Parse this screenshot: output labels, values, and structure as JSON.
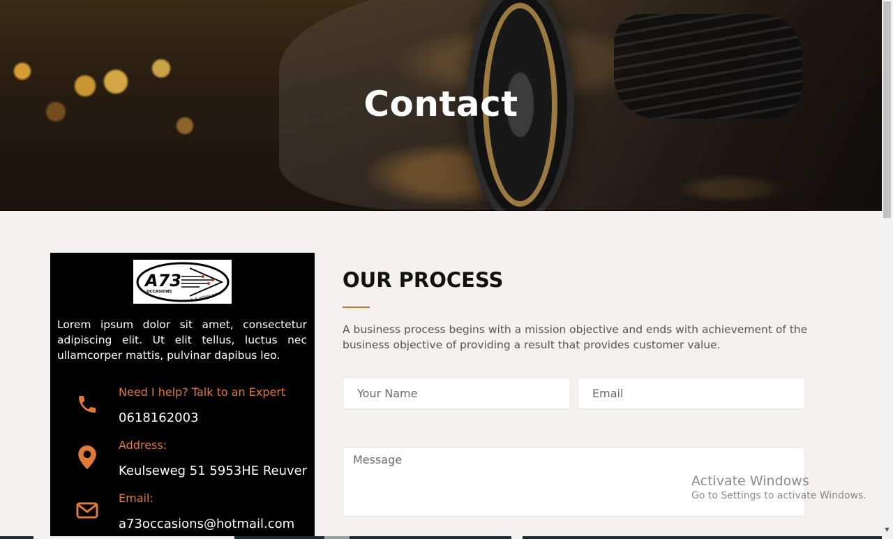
{
  "hero": {
    "title": "Contact"
  },
  "card": {
    "logo": {
      "main": "A73",
      "sub": "OCCASIONS",
      "tagline": "in- & verkoop auto's"
    },
    "description": "Lorem ipsum dolor sit amet, consectetur adipiscing elit. Ut elit tellus, luctus nec ullamcorper mattis, pulvinar dapibus leo.",
    "contacts": [
      {
        "icon": "phone-icon",
        "label": "Need I help? Talk to an Expert",
        "value": "0618162003"
      },
      {
        "icon": "map-pin-icon",
        "label": "Address:",
        "value": "Keulseweg 51 5953HE Reuver"
      },
      {
        "icon": "envelope-icon",
        "label": "Email:",
        "value": "a73occasions@hotmail.com"
      }
    ]
  },
  "process": {
    "title": "OUR PROCESS",
    "text": "A business process begins with a mission objective and ends with achievement of the business objective of providing a result that provides customer value."
  },
  "form": {
    "name_placeholder": "Your Name",
    "email_placeholder": "Email",
    "message_placeholder": "Message"
  },
  "watermark": {
    "title": "Activate Windows",
    "subtitle": "Go to Settings to activate Windows."
  },
  "colors": {
    "accent": "#d0702c",
    "card_bg": "#000000",
    "page_bg": "#f4f1f0"
  }
}
